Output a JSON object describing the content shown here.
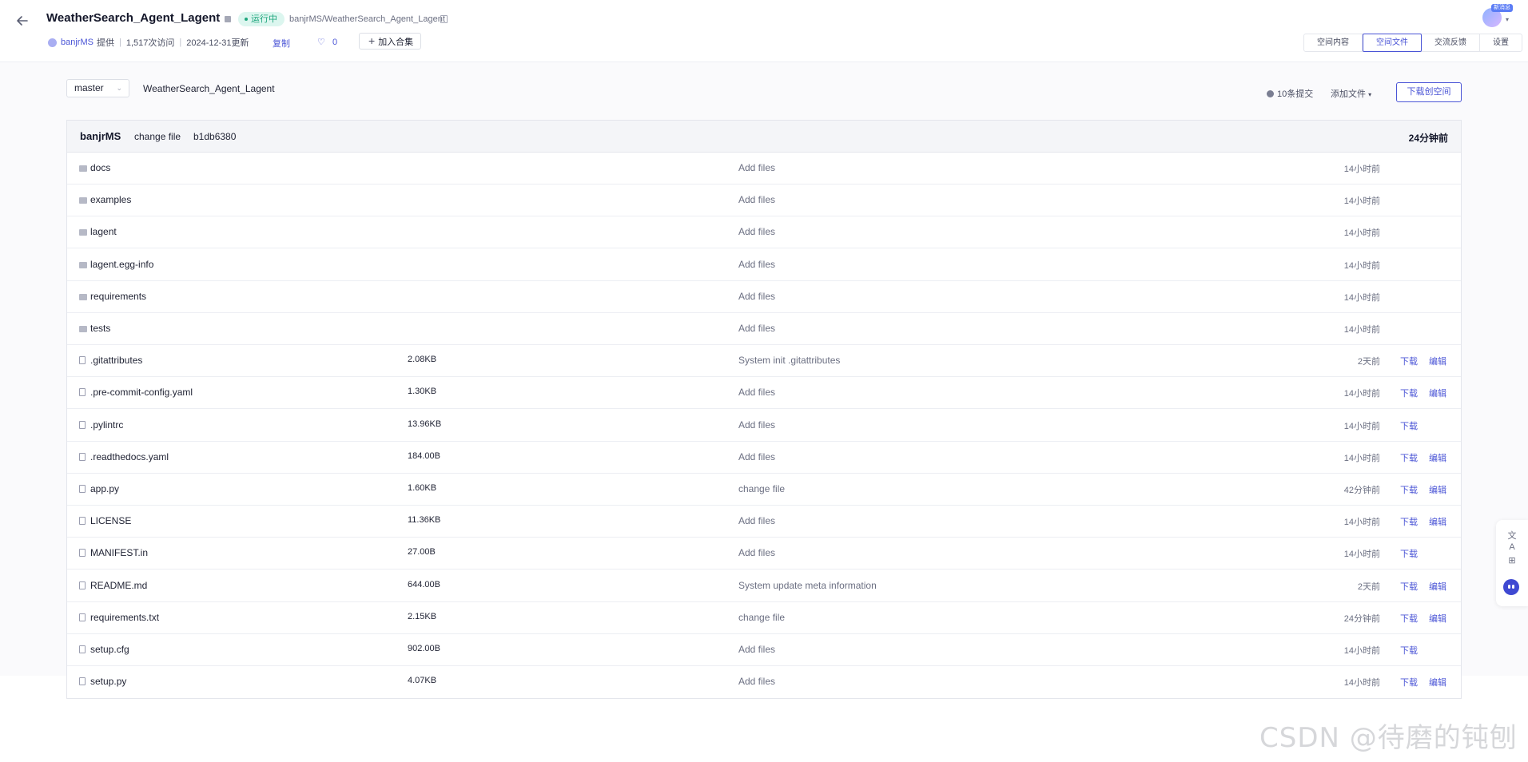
{
  "header": {
    "title": "WeatherSearch_Agent_Lagent",
    "status": "运行中",
    "repo_path": "banjrMS/WeatherSearch_Agent_Lagent",
    "author": "banjrMS",
    "provided": "提供",
    "visits": "1,517次访问",
    "updated": "2024-12-31更新",
    "copy_label": "复制",
    "likes": "0",
    "collect_label": "加入合集",
    "avatar_badge": "新消息",
    "tabs": [
      {
        "label": "空间内容",
        "active": false
      },
      {
        "label": "空间文件",
        "active": true
      },
      {
        "label": "交流反馈",
        "active": false
      },
      {
        "label": "设置",
        "active": false
      }
    ]
  },
  "repo_bar": {
    "branch": "master",
    "repo_name": "WeatherSearch_Agent_Lagent",
    "commits": "10条提交",
    "add_file": "添加文件",
    "download_space": "下载创空间"
  },
  "latest_commit": {
    "author": "banjrMS",
    "message": "change file",
    "hash": "b1db6380",
    "time": "24分钟前"
  },
  "download_label": "下载",
  "edit_label": "编辑",
  "files": [
    {
      "name": "docs",
      "type": "folder",
      "size": "",
      "message": "Add files",
      "time": "14小时前",
      "download": false,
      "edit": false
    },
    {
      "name": "examples",
      "type": "folder",
      "size": "",
      "message": "Add files",
      "time": "14小时前",
      "download": false,
      "edit": false
    },
    {
      "name": "lagent",
      "type": "folder",
      "size": "",
      "message": "Add files",
      "time": "14小时前",
      "download": false,
      "edit": false
    },
    {
      "name": "lagent.egg-info",
      "type": "folder",
      "size": "",
      "message": "Add files",
      "time": "14小时前",
      "download": false,
      "edit": false
    },
    {
      "name": "requirements",
      "type": "folder",
      "size": "",
      "message": "Add files",
      "time": "14小时前",
      "download": false,
      "edit": false
    },
    {
      "name": "tests",
      "type": "folder",
      "size": "",
      "message": "Add files",
      "time": "14小时前",
      "download": false,
      "edit": false
    },
    {
      "name": ".gitattributes",
      "type": "file",
      "size": "2.08KB",
      "message": "System init .gitattributes",
      "time": "2天前",
      "download": true,
      "edit": true
    },
    {
      "name": ".pre-commit-config.yaml",
      "type": "file",
      "size": "1.30KB",
      "message": "Add files",
      "time": "14小时前",
      "download": true,
      "edit": true
    },
    {
      "name": ".pylintrc",
      "type": "file",
      "size": "13.96KB",
      "message": "Add files",
      "time": "14小时前",
      "download": true,
      "edit": false
    },
    {
      "name": ".readthedocs.yaml",
      "type": "file",
      "size": "184.00B",
      "message": "Add files",
      "time": "14小时前",
      "download": true,
      "edit": true
    },
    {
      "name": "app.py",
      "type": "file",
      "size": "1.60KB",
      "message": "change file",
      "time": "42分钟前",
      "download": true,
      "edit": true
    },
    {
      "name": "LICENSE",
      "type": "file",
      "size": "11.36KB",
      "message": "Add files",
      "time": "14小时前",
      "download": true,
      "edit": true
    },
    {
      "name": "MANIFEST.in",
      "type": "file",
      "size": "27.00B",
      "message": "Add files",
      "time": "14小时前",
      "download": true,
      "edit": false
    },
    {
      "name": "README.md",
      "type": "file",
      "size": "644.00B",
      "message": "System update meta information",
      "time": "2天前",
      "download": true,
      "edit": true
    },
    {
      "name": "requirements.txt",
      "type": "file",
      "size": "2.15KB",
      "message": "change file",
      "time": "24分钟前",
      "download": true,
      "edit": true
    },
    {
      "name": "setup.cfg",
      "type": "file",
      "size": "902.00B",
      "message": "Add files",
      "time": "14小时前",
      "download": true,
      "edit": false
    },
    {
      "name": "setup.py",
      "type": "file",
      "size": "4.07KB",
      "message": "Add files",
      "time": "14小时前",
      "download": true,
      "edit": true
    }
  ],
  "side_tools": [
    "translate-icon",
    "grid-icon",
    "robot-icon"
  ],
  "watermark": "CSDN @待磨的钝刨"
}
